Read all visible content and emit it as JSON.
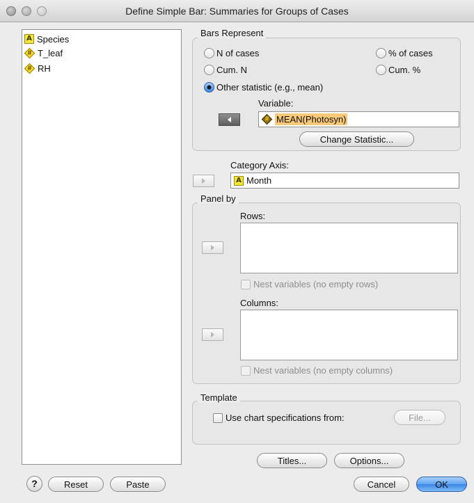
{
  "window": {
    "title": "Define Simple Bar: Summaries for Groups of Cases"
  },
  "variables": [
    {
      "name": "Species",
      "type": "string",
      "icon": "string-variable-icon"
    },
    {
      "name": "T_leaf",
      "type": "numeric",
      "icon": "numeric-variable-icon"
    },
    {
      "name": "RH",
      "type": "numeric",
      "icon": "numeric-variable-icon"
    }
  ],
  "bars_represent": {
    "label": "Bars Represent",
    "n_of_cases": "N of cases",
    "pct_of_cases": "% of cases",
    "cum_n": "Cum. N",
    "cum_pct": "Cum. %",
    "other_statistic": "Other statistic (e.g., mean)",
    "selected": "other_statistic",
    "variable_label": "Variable:",
    "variable_value": "MEAN(Photosyn)",
    "change_statistic": "Change Statistic..."
  },
  "category_axis": {
    "label": "Category Axis:",
    "value": "Month"
  },
  "panel_by": {
    "label": "Panel by",
    "rows_label": "Rows:",
    "nest_rows": "Nest variables (no empty rows)",
    "columns_label": "Columns:",
    "nest_columns": "Nest variables (no empty columns)"
  },
  "template": {
    "label": "Template",
    "use_chart_specs": "Use chart specifications from:",
    "file_button": "File..."
  },
  "buttons": {
    "titles": "Titles...",
    "options": "Options...",
    "help": "?",
    "reset": "Reset",
    "paste": "Paste",
    "cancel": "Cancel",
    "ok": "OK"
  },
  "colors": {
    "default_button": "#3a86e6",
    "selection_highlight": "#f7c978",
    "string_badge": "#f5e536",
    "numeric_badge": "#f2d930"
  }
}
